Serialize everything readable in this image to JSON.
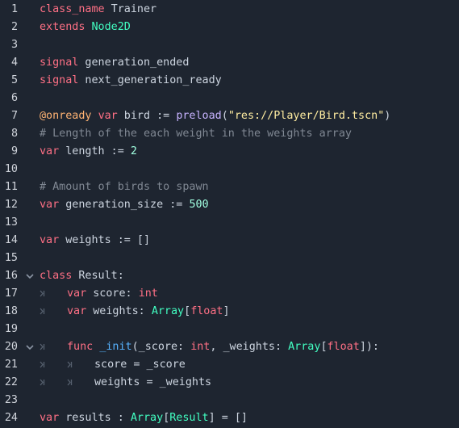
{
  "editor": {
    "lines": [
      {
        "n": "1",
        "tokens": [
          {
            "t": "class_name",
            "c": "kw"
          },
          {
            "t": " Trainer",
            "c": "plain"
          }
        ]
      },
      {
        "n": "2",
        "tokens": [
          {
            "t": "extends",
            "c": "kw"
          },
          {
            "t": " ",
            "c": "plain"
          },
          {
            "t": "Node2D",
            "c": "type"
          }
        ]
      },
      {
        "n": "3",
        "tokens": []
      },
      {
        "n": "4",
        "tokens": [
          {
            "t": "signal",
            "c": "kw"
          },
          {
            "t": " generation_ended",
            "c": "plain"
          }
        ]
      },
      {
        "n": "5",
        "tokens": [
          {
            "t": "signal",
            "c": "kw"
          },
          {
            "t": " next_generation_ready",
            "c": "plain"
          }
        ]
      },
      {
        "n": "6",
        "tokens": []
      },
      {
        "n": "7",
        "tokens": [
          {
            "t": "@onready",
            "c": "ann"
          },
          {
            "t": " ",
            "c": "plain"
          },
          {
            "t": "var",
            "c": "kw"
          },
          {
            "t": " bird := ",
            "c": "plain"
          },
          {
            "t": "preload",
            "c": "builtin"
          },
          {
            "t": "(",
            "c": "plain"
          },
          {
            "t": "\"res://Player/Bird.tscn\"",
            "c": "str"
          },
          {
            "t": ")",
            "c": "plain"
          }
        ]
      },
      {
        "n": "8",
        "tokens": [
          {
            "t": "# Length of the each weight in the weights array",
            "c": "cm"
          }
        ]
      },
      {
        "n": "9",
        "tokens": [
          {
            "t": "var",
            "c": "kw"
          },
          {
            "t": " length := ",
            "c": "plain"
          },
          {
            "t": "2",
            "c": "num"
          }
        ]
      },
      {
        "n": "10",
        "tokens": []
      },
      {
        "n": "11",
        "tokens": [
          {
            "t": "# Amount of birds to spawn",
            "c": "cm"
          }
        ]
      },
      {
        "n": "12",
        "tokens": [
          {
            "t": "var",
            "c": "kw"
          },
          {
            "t": " generation_size := ",
            "c": "plain"
          },
          {
            "t": "500",
            "c": "num"
          }
        ]
      },
      {
        "n": "13",
        "tokens": []
      },
      {
        "n": "14",
        "tokens": [
          {
            "t": "var",
            "c": "kw"
          },
          {
            "t": " weights := []",
            "c": "plain"
          }
        ]
      },
      {
        "n": "15",
        "tokens": []
      },
      {
        "n": "16",
        "fold": true,
        "tokens": [
          {
            "t": "class",
            "c": "kw"
          },
          {
            "t": " Result:",
            "c": "plain"
          }
        ]
      },
      {
        "n": "17",
        "indent": 1,
        "tokens": [
          {
            "t": "var",
            "c": "kw"
          },
          {
            "t": " score: ",
            "c": "plain"
          },
          {
            "t": "int",
            "c": "kw"
          }
        ]
      },
      {
        "n": "18",
        "indent": 1,
        "tokens": [
          {
            "t": "var",
            "c": "kw"
          },
          {
            "t": " weights: ",
            "c": "plain"
          },
          {
            "t": "Array",
            "c": "type"
          },
          {
            "t": "[",
            "c": "plain"
          },
          {
            "t": "float",
            "c": "kw"
          },
          {
            "t": "]",
            "c": "plain"
          }
        ]
      },
      {
        "n": "19",
        "tokens": []
      },
      {
        "n": "20",
        "fold": true,
        "indent": 1,
        "tokens": [
          {
            "t": "func",
            "c": "kw"
          },
          {
            "t": " ",
            "c": "plain"
          },
          {
            "t": "_init",
            "c": "fn"
          },
          {
            "t": "(_score: ",
            "c": "plain"
          },
          {
            "t": "int",
            "c": "kw"
          },
          {
            "t": ", _weights: ",
            "c": "plain"
          },
          {
            "t": "Array",
            "c": "type"
          },
          {
            "t": "[",
            "c": "plain"
          },
          {
            "t": "float",
            "c": "kw"
          },
          {
            "t": "]):",
            "c": "plain"
          }
        ]
      },
      {
        "n": "21",
        "indent": 2,
        "tokens": [
          {
            "t": "score = _score",
            "c": "plain"
          }
        ]
      },
      {
        "n": "22",
        "indent": 2,
        "tokens": [
          {
            "t": "weights = _weights",
            "c": "plain"
          }
        ]
      },
      {
        "n": "23",
        "tokens": []
      },
      {
        "n": "24",
        "tokens": [
          {
            "t": "var",
            "c": "kw"
          },
          {
            "t": " results : ",
            "c": "plain"
          },
          {
            "t": "Array",
            "c": "type"
          },
          {
            "t": "[",
            "c": "plain"
          },
          {
            "t": "Result",
            "c": "type"
          },
          {
            "t": "] = []",
            "c": "plain"
          }
        ]
      }
    ]
  },
  "colors": {
    "background": "#1e2530",
    "line_number": "#cfd3da",
    "keyword": "#ff7085",
    "type": "#42ffc2",
    "number": "#a1ffe0",
    "string": "#ffeda1",
    "comment": "#808893",
    "annotation": "#ffb373",
    "function": "#57b3ff",
    "builtin": "#c7b3ff"
  },
  "icons": {
    "fold": "chevron-down-icon",
    "tab": "tab-indent-icon"
  }
}
